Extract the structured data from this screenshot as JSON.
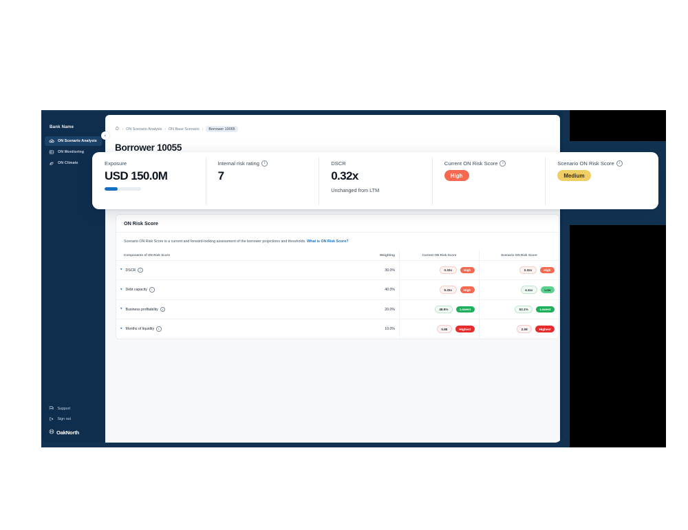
{
  "sidebar": {
    "bank_name": "Bank Name",
    "items": [
      {
        "label": "ON Scenario Analysis",
        "icon": "cloud-chart-icon",
        "active": true
      },
      {
        "label": "ON Monitoring",
        "icon": "monitor-icon",
        "active": false
      },
      {
        "label": "ON Climate",
        "icon": "climate-leaf-icon",
        "active": false
      }
    ],
    "footer": [
      {
        "label": "Support",
        "icon": "support-chat-icon"
      },
      {
        "label": "Sign out",
        "icon": "sign-out-icon"
      }
    ],
    "brand": "OakNorth",
    "collapse_icon": "chevron-left-icon"
  },
  "breadcrumb": {
    "home_icon": "home-icon",
    "separator": "›",
    "items": [
      {
        "label": "ON Scenario Analysis",
        "current": false
      },
      {
        "label": "ON Base Scenario",
        "current": false
      },
      {
        "label": "Borrower 10055",
        "current": true
      }
    ]
  },
  "page": {
    "title": "Borrower 10055"
  },
  "kpis": [
    {
      "label": "Exposure",
      "value": "USD 150.0M",
      "has_info": false,
      "progress_percent": 35,
      "sub": ""
    },
    {
      "label": "Internal risk rating",
      "value": "7",
      "has_info": true,
      "sub": ""
    },
    {
      "label": "DSCR",
      "value": "0.32x",
      "has_info": false,
      "sub": "Unchanged from LTM"
    },
    {
      "label": "Current ON Risk Score",
      "has_info": true,
      "badge": {
        "text": "High",
        "style": "high"
      }
    },
    {
      "label": "Scenario ON Risk Score",
      "has_info": true,
      "badge": {
        "text": "Medium",
        "style": "medium"
      }
    }
  ],
  "risk_panel": {
    "title": "ON Risk Score",
    "description": "Scenario ON Risk Score is a current and forward-looking assessment of the borrower projections and thresholds.",
    "link_text": "What is ON Risk Score?",
    "columns": {
      "component": "Components of ON Risk Score",
      "weighting": "Weighting",
      "current": "Current ON Risk Score",
      "scenario": "Scenario ON Risk Score"
    },
    "rows": [
      {
        "component": "DSCR",
        "has_info": true,
        "weighting": "30.0%",
        "current": {
          "value": "0.33x",
          "value_style": "red",
          "tag": "High",
          "tag_style": "high"
        },
        "scenario": {
          "value": "0.32x",
          "value_style": "red",
          "tag": "High",
          "tag_style": "high"
        }
      },
      {
        "component": "Debt capacity",
        "has_info": true,
        "weighting": "40.0%",
        "current": {
          "value": "5.33x",
          "value_style": "red",
          "tag": "High",
          "tag_style": "high"
        },
        "scenario": {
          "value": "4.11x",
          "value_style": "green",
          "tag": "Low",
          "tag_style": "low"
        }
      },
      {
        "component": "Business profitability",
        "has_info": true,
        "weighting": "20.0%",
        "current": {
          "value": "48.5%",
          "value_style": "green",
          "tag": "Lowest",
          "tag_style": "lowest"
        },
        "scenario": {
          "value": "52.1%",
          "value_style": "green",
          "tag": "Lowest",
          "tag_style": "lowest"
        }
      },
      {
        "component": "Months of liquidity",
        "has_info": true,
        "weighting": "10.0%",
        "current": {
          "value": "0.85",
          "value_style": "crimson",
          "tag": "Highest",
          "tag_style": "highest"
        },
        "scenario": {
          "value": "2.08",
          "value_style": "crimson",
          "tag": "Highest",
          "tag_style": "highest"
        }
      }
    ]
  },
  "colors": {
    "navy": "#0f2d4d",
    "backdrop_navy": "#123252",
    "accent_blue": "#1570c4",
    "high": "#f4694f",
    "medium": "#f1ce63",
    "low": "#5cd18f",
    "lowest": "#1eae5c",
    "highest": "#e52c2c"
  }
}
